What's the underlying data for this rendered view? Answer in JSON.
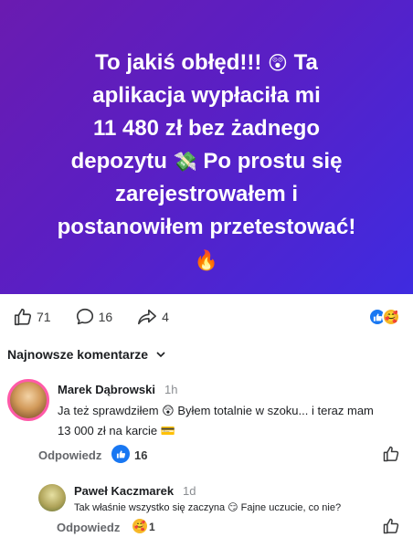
{
  "post": {
    "line1": "To jakiś obłęd!!! ",
    "emoji1": "😲",
    "line1b": " Ta",
    "line2": "aplikacja wypłaciła mi",
    "line3": "11 480 zł bez żadnego",
    "line4a": "depozytu ",
    "emoji2": "💸",
    "line4b": " Po prostu się",
    "line5": "zarejestrowałem i",
    "line6": "postanowiłem przetestować!",
    "emoji3": "🔥"
  },
  "actions": {
    "like_count": "71",
    "comment_count": "16",
    "share_count": "4"
  },
  "reactions": {
    "like_icon": "👍",
    "care_icon": "🥰"
  },
  "comments_header": "Najnowsze komentarze",
  "comments": [
    {
      "author": "Marek Dąbrowski",
      "time": "1h",
      "text": "Ja też sprawdziłem 😲 Byłem totalnie w szoku... i teraz mam 13 000 zł na karcie 💳",
      "reply_label": "Odpowiedz",
      "reaction_count": "16"
    },
    {
      "author": "Paweł Kaczmarek",
      "time": "1d",
      "text": "Tak właśnie wszystko się zaczyna 😏 Fajne uczucie, co nie?",
      "reply_label": "Odpowiedz",
      "reaction_count": "1"
    }
  ],
  "colors": {
    "accent": "#1877f2",
    "banner_start": "#6a1bb0",
    "banner_end": "#3f2be0"
  }
}
